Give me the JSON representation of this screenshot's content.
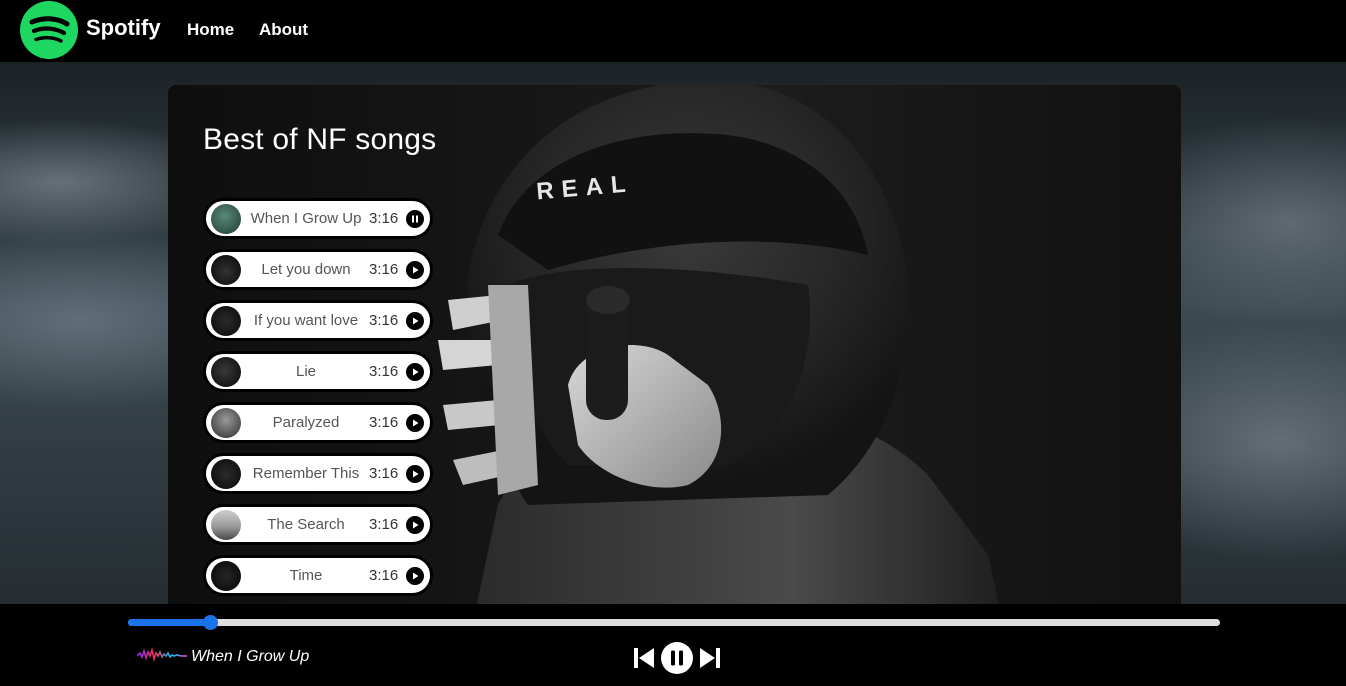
{
  "navbar": {
    "brand": "Spotify",
    "links": [
      {
        "label": "Home"
      },
      {
        "label": "About"
      }
    ]
  },
  "colors": {
    "spotify_green": "#1ED760",
    "progress_blue": "#1a73e8",
    "background": "#000000"
  },
  "playlist": {
    "title": "Best of NF songs",
    "photo_text": "REAL",
    "songs": [
      {
        "name": "When I Grow Up",
        "duration": "3:16",
        "state": "pause-icon"
      },
      {
        "name": "Let you down",
        "duration": "3:16",
        "state": "play-icon"
      },
      {
        "name": "If you want love",
        "duration": "3:16",
        "state": "play-icon"
      },
      {
        "name": "Lie",
        "duration": "3:16",
        "state": "play-icon"
      },
      {
        "name": "Paralyzed",
        "duration": "3:16",
        "state": "play-icon"
      },
      {
        "name": "Remember This",
        "duration": "3:16",
        "state": "play-icon"
      },
      {
        "name": "The Search",
        "duration": "3:16",
        "state": "play-icon"
      },
      {
        "name": "Time",
        "duration": "3:16",
        "state": "play-icon"
      }
    ]
  },
  "player": {
    "now_playing": "When I Grow Up",
    "progress_fraction": 0.075,
    "controls": [
      "previous-icon",
      "pause-icon",
      "next-icon"
    ]
  }
}
